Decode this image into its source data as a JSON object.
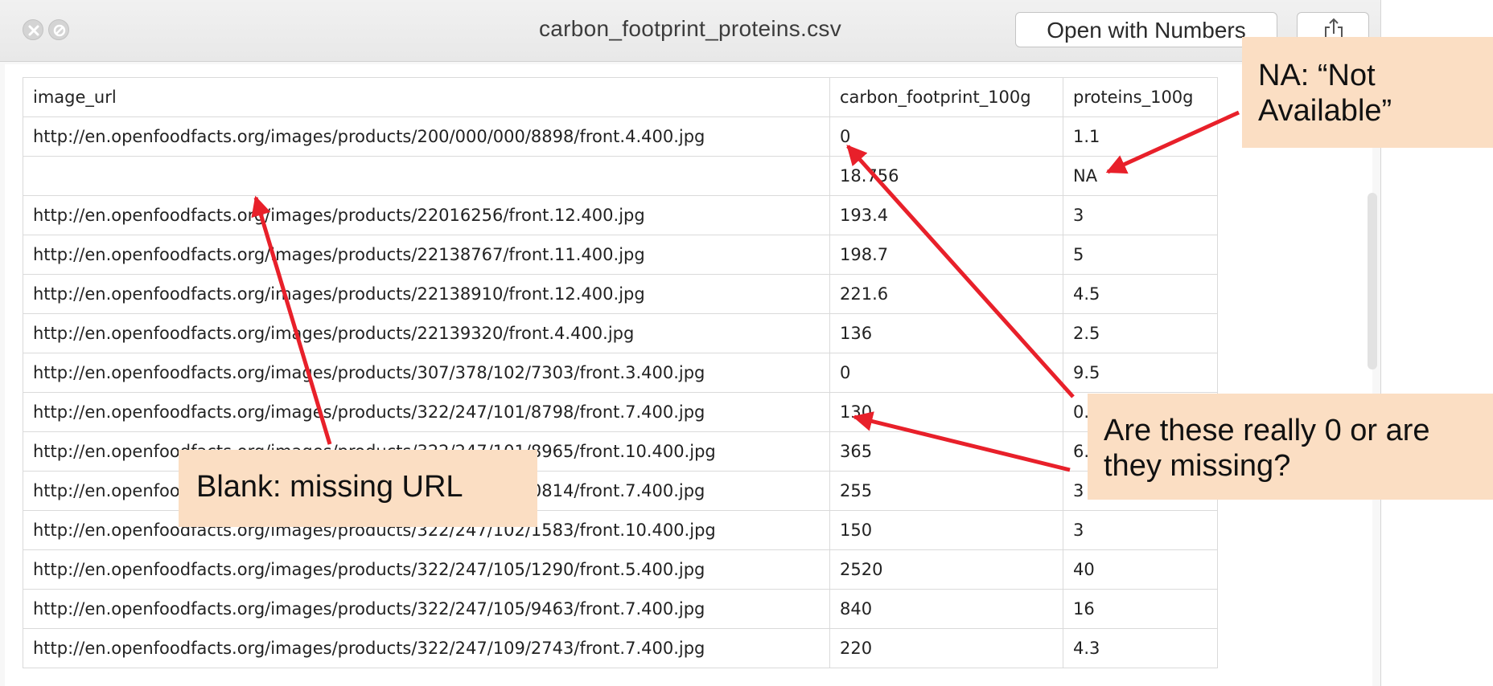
{
  "window": {
    "title": "carbon_footprint_proteins.csv",
    "open_button": "Open with Numbers"
  },
  "table": {
    "headers": [
      "image_url",
      "carbon_footprint_100g",
      "proteins_100g"
    ],
    "rows": [
      [
        "http://en.openfoodfacts.org/images/products/200/000/000/8898/front.4.400.jpg",
        "0",
        "1.1"
      ],
      [
        "",
        "18.756",
        "NA"
      ],
      [
        "http://en.openfoodfacts.org/images/products/22016256/front.12.400.jpg",
        "193.4",
        "3"
      ],
      [
        "http://en.openfoodfacts.org/images/products/22138767/front.11.400.jpg",
        "198.7",
        "5"
      ],
      [
        "http://en.openfoodfacts.org/images/products/22138910/front.12.400.jpg",
        "221.6",
        "4.5"
      ],
      [
        "http://en.openfoodfacts.org/images/products/22139320/front.4.400.jpg",
        "136",
        "2.5"
      ],
      [
        "http://en.openfoodfacts.org/images/products/307/378/102/7303/front.3.400.jpg",
        "0",
        "9.5"
      ],
      [
        "http://en.openfoodfacts.org/images/products/322/247/101/8798/front.7.400.jpg",
        "130",
        "0.1"
      ],
      [
        "http://en.openfoodfacts.org/images/products/322/247/101/8965/front.10.400.jpg",
        "365",
        "6.2"
      ],
      [
        "http://en.openfoodfacts.org/images/products/322/247/102/0814/front.7.400.jpg",
        "255",
        "3"
      ],
      [
        "http://en.openfoodfacts.org/images/products/322/247/102/1583/front.10.400.jpg",
        "150",
        "3"
      ],
      [
        "http://en.openfoodfacts.org/images/products/322/247/105/1290/front.5.400.jpg",
        "2520",
        "40"
      ],
      [
        "http://en.openfoodfacts.org/images/products/322/247/105/9463/front.7.400.jpg",
        "840",
        "16"
      ],
      [
        "http://en.openfoodfacts.org/images/products/322/247/109/2743/front.7.400.jpg",
        "220",
        "4.3"
      ]
    ]
  },
  "callouts": {
    "na_line1": "NA: “Not",
    "na_line2": "Available”",
    "zero_line1": "Are these really 0 or are",
    "zero_line2": "they missing?",
    "blank": "Blank: missing URL"
  },
  "colors": {
    "callout_bg": "#fbdec3",
    "arrow": "#e8202a"
  },
  "icons": {
    "close": "close-icon",
    "minimize": "minimize-icon",
    "share": "share-icon"
  }
}
